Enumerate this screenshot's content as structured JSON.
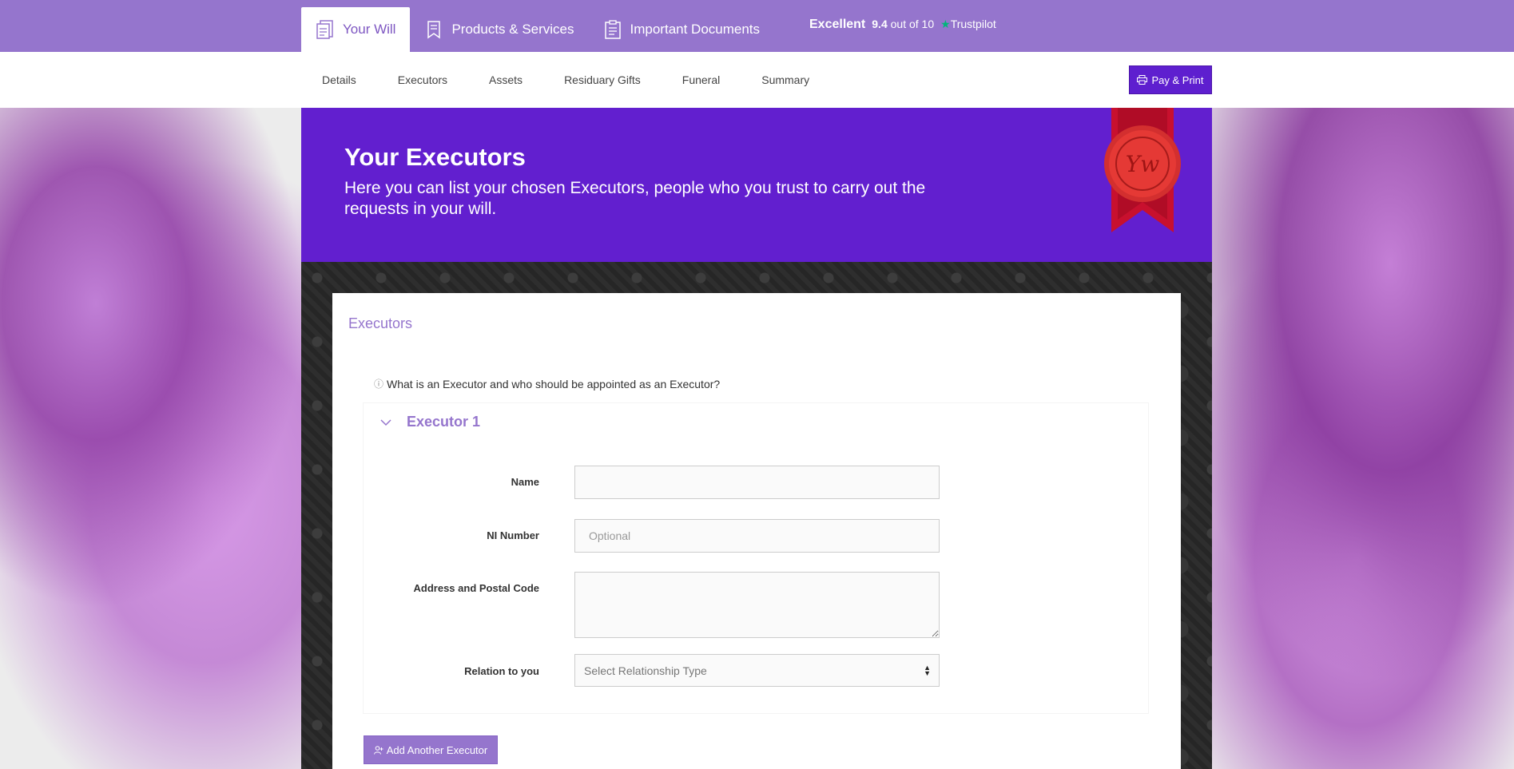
{
  "topnav": {
    "tabs": [
      {
        "label": "Your Will",
        "icon": "will-document-icon",
        "active": true
      },
      {
        "label": "Products & Services",
        "icon": "bookmark-icon",
        "active": false
      },
      {
        "label": "Important Documents",
        "icon": "clipboard-icon",
        "active": false
      }
    ],
    "trustpilot": {
      "rating_word": "Excellent",
      "score": "9.4",
      "score_suffix": "out of 10",
      "brand": "Trustpilot",
      "star_color": "#00b67a"
    }
  },
  "subnav": {
    "items": [
      "Details",
      "Executors",
      "Assets",
      "Residuary Gifts",
      "Funeral",
      "Summary"
    ],
    "pay_button": "Pay & Print"
  },
  "hero": {
    "title": "Your Executors",
    "subtitle": "Here you can list your chosen Executors, people who you trust to carry out the requests in your will.",
    "seal_letters": "Yw"
  },
  "card": {
    "title": "Executors",
    "help_text": "What is an Executor and who should be appointed as an Executor?",
    "executor_panel": {
      "heading": "Executor 1",
      "fields": {
        "name_label": "Name",
        "name_value": "",
        "ni_label": "NI Number",
        "ni_placeholder": "Optional",
        "address_label": "Address and Postal Code",
        "address_value": "",
        "relation_label": "Relation to you",
        "relation_selected": "Select Relationship Type"
      }
    },
    "add_button": "Add Another Executor"
  },
  "colors": {
    "topbar": "#9575cd",
    "hero": "#621fcf",
    "pay_button": "#5e1fcf",
    "accent": "#9575cd"
  }
}
